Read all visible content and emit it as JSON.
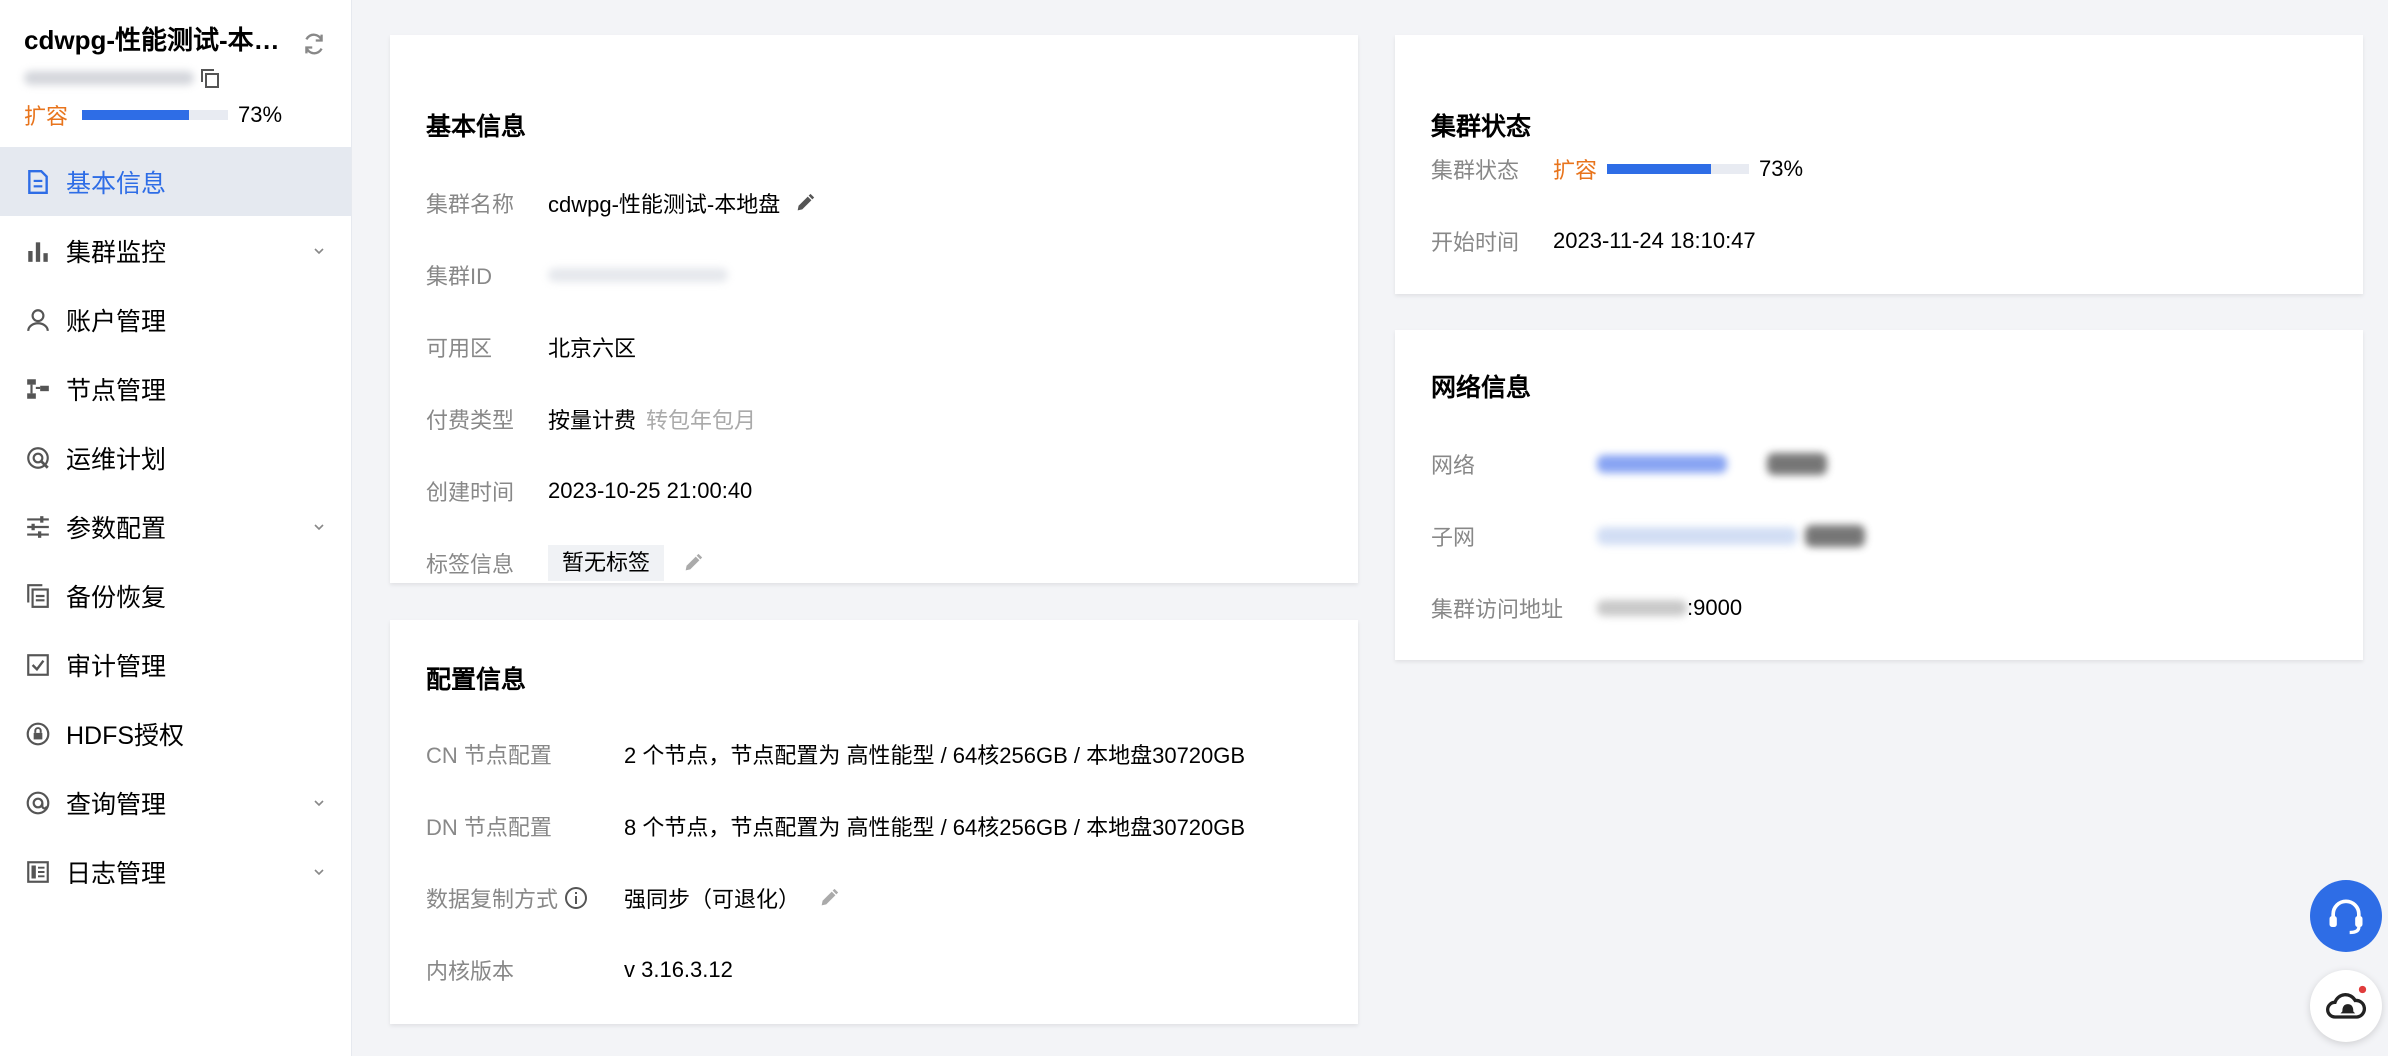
{
  "sidebar": {
    "cluster_title": "cdwpg-性能测试-本地盘",
    "status": "扩容",
    "progress_percent": 73,
    "progress_label": "73%",
    "items": [
      {
        "label": "基本信息",
        "icon": "document-icon",
        "active": true,
        "has_chevron": false
      },
      {
        "label": "集群监控",
        "icon": "bar-chart-icon",
        "active": false,
        "has_chevron": true
      },
      {
        "label": "账户管理",
        "icon": "user-icon",
        "active": false,
        "has_chevron": false
      },
      {
        "label": "节点管理",
        "icon": "node-icon",
        "active": false,
        "has_chevron": false
      },
      {
        "label": "运维计划",
        "icon": "ops-plan-icon",
        "active": false,
        "has_chevron": false
      },
      {
        "label": "参数配置",
        "icon": "sliders-icon",
        "active": false,
        "has_chevron": true
      },
      {
        "label": "备份恢复",
        "icon": "backup-icon",
        "active": false,
        "has_chevron": false
      },
      {
        "label": "审计管理",
        "icon": "audit-check-icon",
        "active": false,
        "has_chevron": false
      },
      {
        "label": "HDFS授权",
        "icon": "hdfs-auth-icon",
        "active": false,
        "has_chevron": false
      },
      {
        "label": "查询管理",
        "icon": "query-icon",
        "active": false,
        "has_chevron": true
      },
      {
        "label": "日志管理",
        "icon": "log-icon",
        "active": false,
        "has_chevron": true
      }
    ]
  },
  "basic_info": {
    "title": "基本信息",
    "name_label": "集群名称",
    "name_value": "cdwpg-性能测试-本地盘",
    "id_label": "集群ID",
    "zone_label": "可用区",
    "zone_value": "北京六区",
    "billing_label": "付费类型",
    "billing_value": "按量计费",
    "billing_action": "转包年包月",
    "created_label": "创建时间",
    "created_value": "2023-10-25 21:00:40",
    "tags_label": "标签信息",
    "tags_value": "暂无标签"
  },
  "config_info": {
    "title": "配置信息",
    "cn_label": "CN 节点配置",
    "cn_value": "2 个节点，节点配置为 高性能型 / 64核256GB / 本地盘30720GB",
    "dn_label": "DN 节点配置",
    "dn_value": "8 个节点，节点配置为 高性能型 / 64核256GB / 本地盘30720GB",
    "replication_label": "数据复制方式",
    "replication_value": "强同步（可退化）",
    "kernel_label": "内核版本",
    "kernel_value": "v 3.16.3.12"
  },
  "cluster_status": {
    "title": "集群状态",
    "status_label": "集群状态",
    "status_value": "扩容",
    "progress_percent": 73,
    "progress_label": "73%",
    "start_label": "开始时间",
    "start_value": "2023-11-24 18:10:47"
  },
  "network_info": {
    "title": "网络信息",
    "network_label": "网络",
    "subnet_label": "子网",
    "access_label": "集群访问地址",
    "access_port": ":9000"
  },
  "colors": {
    "accent": "#2e6de6",
    "status_orange": "#e8741c",
    "background": "#f3f4f7"
  }
}
